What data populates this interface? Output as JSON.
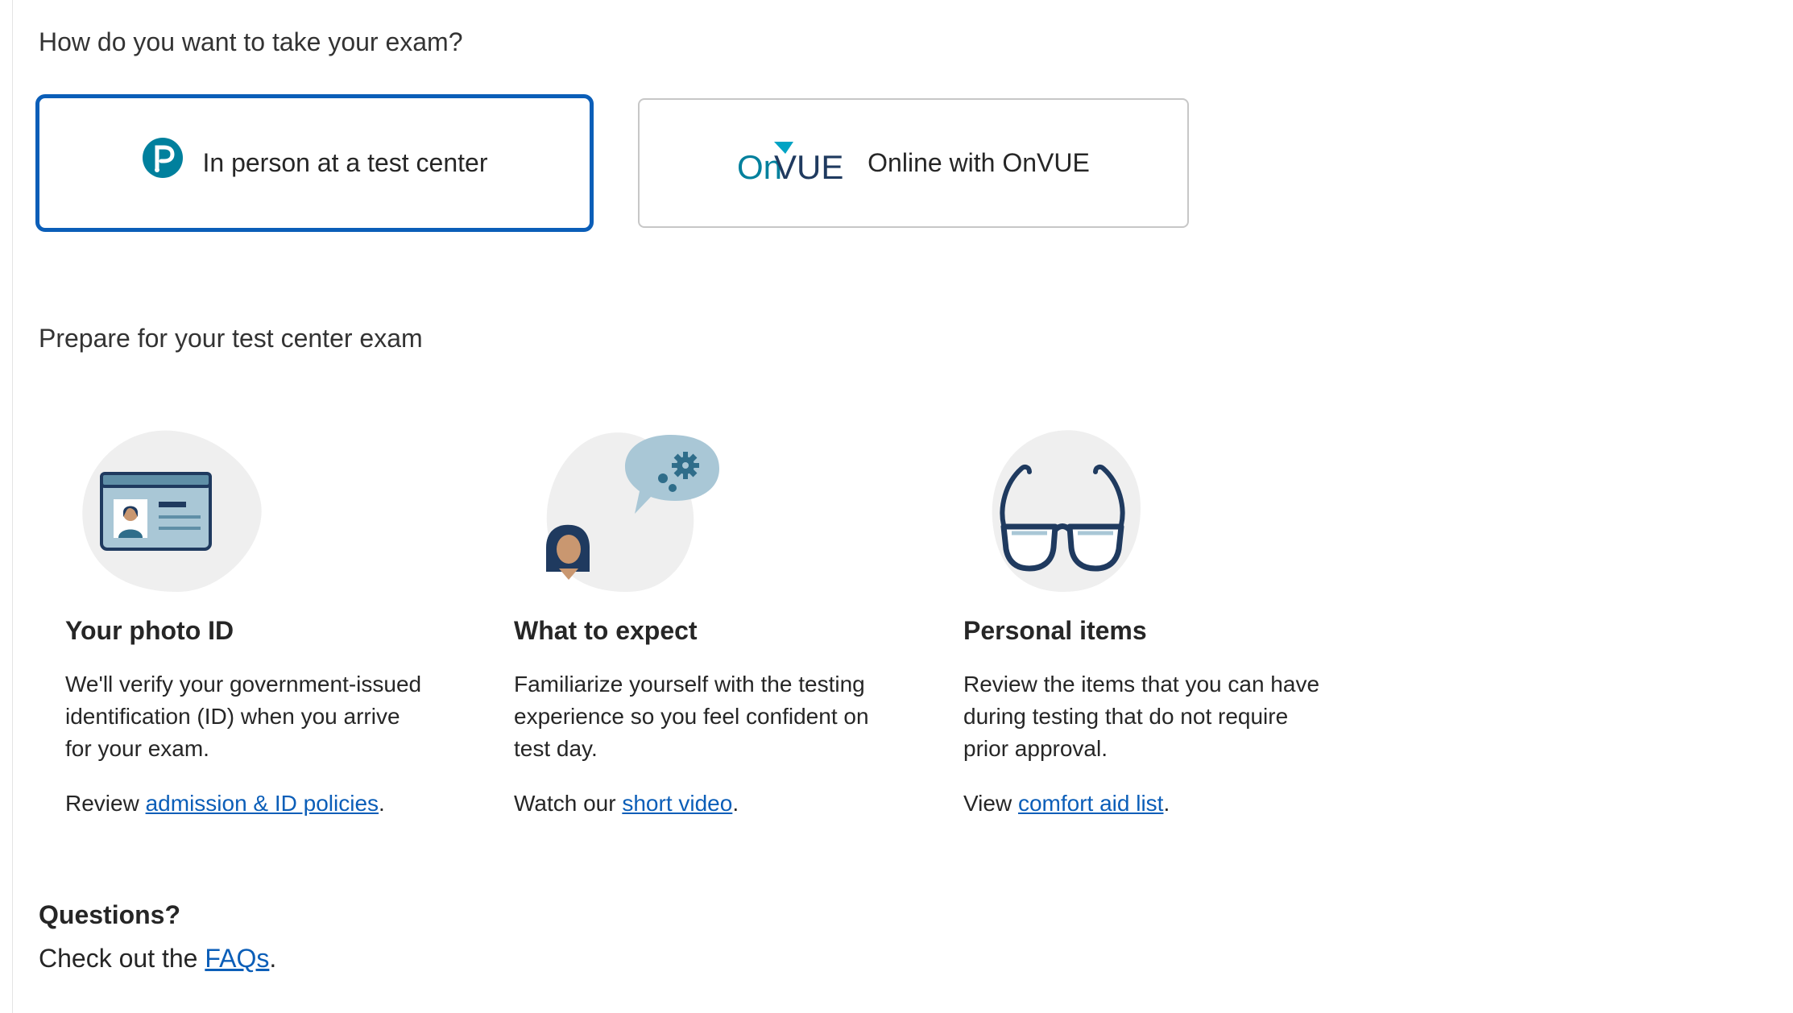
{
  "question": "How do you want to take your exam?",
  "options": {
    "in_person": {
      "label": "In person at a test center",
      "icon": "pearson-logo-icon",
      "selected": true
    },
    "online": {
      "label": "Online with OnVUE",
      "logo_text_on": "On",
      "logo_text_vue": "VUE",
      "icon": "onvue-logo"
    }
  },
  "prepare_title": "Prepare for your test center exam",
  "cards": [
    {
      "icon": "id-card-icon",
      "title": "Your photo ID",
      "text": "We'll verify your government-issued identification (ID) when you arrive for your exam.",
      "cta_prefix": "Review ",
      "link": "admission & ID policies",
      "cta_suffix": "."
    },
    {
      "icon": "thinking-person-gears-icon",
      "title": "What to expect",
      "text": "Familiarize yourself with the testing experience so you feel confident on test day.",
      "cta_prefix": "Watch our ",
      "link": "short video",
      "cta_suffix": "."
    },
    {
      "icon": "eyeglasses-icon",
      "title": "Personal items",
      "text": "Review the items that you can have during testing that do not require prior approval.",
      "cta_prefix": "View ",
      "link": "comfort aid list",
      "cta_suffix": "."
    }
  ],
  "questions": {
    "title": "Questions?",
    "prefix": "Check out the ",
    "link": "FAQs",
    "suffix": "."
  },
  "colors": {
    "accent": "#0b5eb8",
    "teal": "#00809d",
    "navy": "#1f3a5f",
    "blob": "#efefef"
  }
}
